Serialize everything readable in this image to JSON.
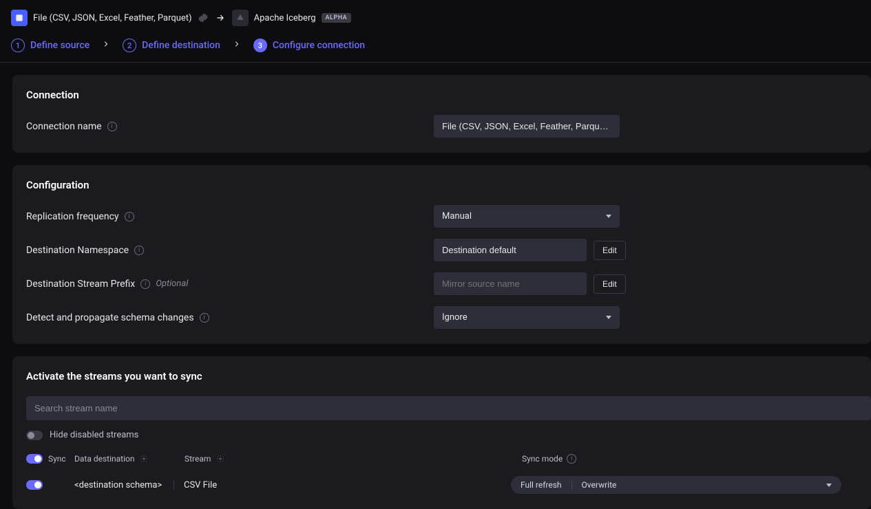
{
  "topbar": {
    "source_name": "File (CSV, JSON, Excel, Feather, Parquet)",
    "destination_name": "Apache Iceberg",
    "alpha_label": "ALPHA"
  },
  "stepper": {
    "steps": [
      {
        "num": "1",
        "label": "Define source"
      },
      {
        "num": "2",
        "label": "Define destination"
      },
      {
        "num": "3",
        "label": "Configure connection"
      }
    ]
  },
  "connection": {
    "title": "Connection",
    "name_label": "Connection name",
    "name_value": "File (CSV, JSON, Excel, Feather, Parquet) →"
  },
  "configuration": {
    "title": "Configuration",
    "replication_label": "Replication frequency",
    "replication_value": "Manual",
    "namespace_label": "Destination Namespace",
    "namespace_value": "Destination default",
    "prefix_label": "Destination Stream Prefix",
    "prefix_optional": "Optional",
    "prefix_placeholder": "Mirror source name",
    "schema_label": "Detect and propagate schema changes",
    "schema_value": "Ignore",
    "edit_label": "Edit"
  },
  "streams": {
    "title": "Activate the streams you want to sync",
    "search_placeholder": "Search stream name",
    "hide_disabled_label": "Hide disabled streams",
    "header": {
      "sync": "Sync",
      "data_destination": "Data destination",
      "stream": "Stream",
      "sync_mode": "Sync mode"
    },
    "row": {
      "destination_schema": "<destination schema>",
      "stream_name": "CSV File",
      "mode_left": "Full refresh",
      "mode_right": "Overwrite"
    }
  }
}
